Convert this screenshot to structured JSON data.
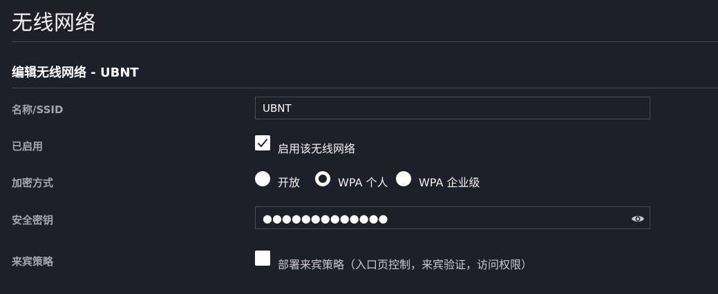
{
  "page": {
    "title": "无线网络"
  },
  "section": {
    "title": "编辑无线网络 - UBNT"
  },
  "fields": {
    "ssid": {
      "label": "名称/SSID",
      "value": "UBNT"
    },
    "enabled": {
      "label": "已启用",
      "checkbox_label": "启用该无线网络",
      "checked": true
    },
    "encryption": {
      "label": "加密方式",
      "options": [
        {
          "label": "开放",
          "selected": false
        },
        {
          "label": "WPA 个人",
          "selected": true
        },
        {
          "label": "WPA 企业级",
          "selected": false
        }
      ]
    },
    "security_key": {
      "label": "安全密钥",
      "masked_value": "●●●●●●●●●●●●●",
      "icon": "eye-icon"
    },
    "guest_policy": {
      "label": "来宾策略",
      "checkbox_label": "部署来宾策略（入口页控制，来宾验证，访问权限）",
      "checked": false
    }
  },
  "colors": {
    "background": "#1f1f2c",
    "label": "#a6a6ad",
    "divider": "#4a4a57",
    "input_border": "#4c4c58"
  }
}
